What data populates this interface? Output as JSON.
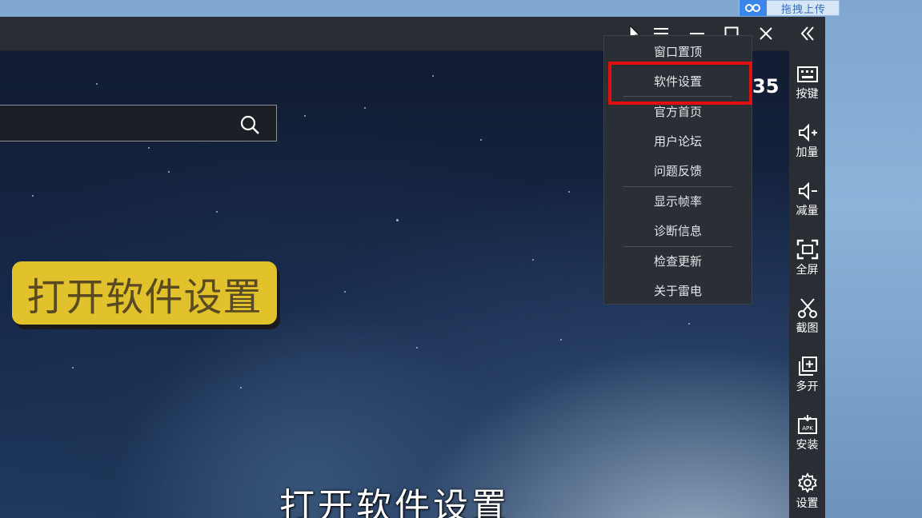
{
  "desktop": {
    "upload_tag": "拖拽上传"
  },
  "titlebar": {
    "buttons": [
      "cursor-icon",
      "menu-icon",
      "minimize-icon",
      "maximize-icon",
      "close-icon"
    ]
  },
  "screen": {
    "clock_fragment": "35",
    "callout_text": "打开软件设置",
    "subtitle_text": "打开软件设置"
  },
  "menu": {
    "items": [
      {
        "label": "窗口置顶"
      },
      {
        "label": "软件设置"
      },
      {
        "label": "官方首页"
      },
      {
        "label": "用户论坛"
      },
      {
        "label": "问题反馈"
      },
      {
        "label": "显示帧率"
      },
      {
        "label": "诊断信息"
      },
      {
        "label": "检查更新"
      },
      {
        "label": "关于雷电"
      }
    ],
    "highlighted": "软件设置",
    "highlight_color": "#e01010"
  },
  "sidebar": {
    "items": [
      {
        "label": "按键",
        "icon": "keyboard-icon"
      },
      {
        "label": "加量",
        "icon": "volume-up-icon"
      },
      {
        "label": "减量",
        "icon": "volume-down-icon"
      },
      {
        "label": "全屏",
        "icon": "fullscreen-icon"
      },
      {
        "label": "截图",
        "icon": "scissors-icon"
      },
      {
        "label": "多开",
        "icon": "multi-instance-icon"
      },
      {
        "label": "安装",
        "icon": "apk-install-icon"
      },
      {
        "label": "设置",
        "icon": "gear-icon"
      }
    ]
  },
  "colors": {
    "callout_bg": "#e2c22c",
    "toolbar_bg": "#2a2d33"
  }
}
